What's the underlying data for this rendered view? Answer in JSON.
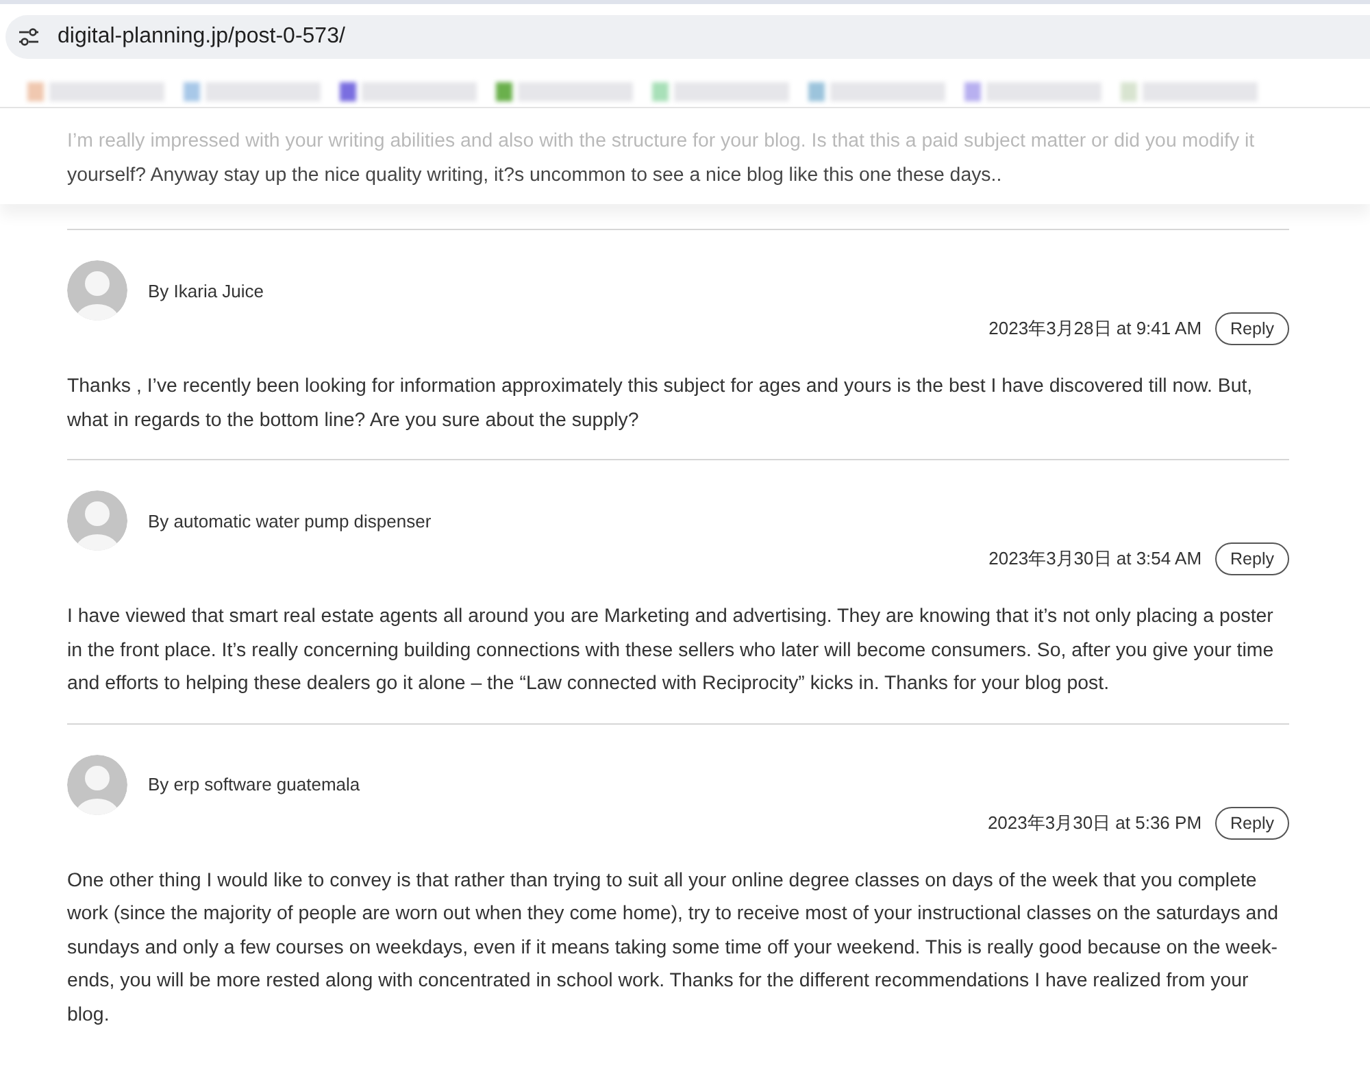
{
  "address_bar": {
    "url": "digital-planning.jp/post-0-573/"
  },
  "bookmarks_bar": {
    "items": [
      {
        "color": "#f0c8b0"
      },
      {
        "color": "#a8c8e8"
      },
      {
        "color": "#7a6ee0"
      },
      {
        "color": "#6ab04c"
      },
      {
        "color": "#a8e0b8"
      },
      {
        "color": "#9cc4dc"
      },
      {
        "color": "#b8b0f0"
      },
      {
        "color": "#d8e4d0"
      }
    ]
  },
  "previous_comment": {
    "text": "I’m really impressed with your writing abilities and also with the structure for your blog. Is that this a paid subject matter or did you modify it yourself? Anyway stay up the nice quality writing, it?s uncommon to see a nice blog like this one these days.."
  },
  "comments": [
    {
      "author": "By Ikaria Juice",
      "date": "2023年3月28日 at 9:41 AM",
      "reply": "Reply",
      "text": "Thanks , I’ve recently been looking for information approximately this subject for ages and yours is the best I have discovered till now. But, what in regards to the bottom line? Are you sure about the supply?"
    },
    {
      "author": "By automatic water pump dispenser",
      "date": "2023年3月30日 at 3:54 AM",
      "reply": "Reply",
      "text": "I have viewed that smart real estate agents all around you are Marketing and advertising. They are knowing that it’s not only placing a poster in the front place. It’s really concerning building connections with these sellers who later will become consumers. So, after you give your time and efforts to helping these dealers go it alone – the “Law connected with Reciprocity” kicks in. Thanks for your blog post."
    },
    {
      "author": "By erp software guatemala",
      "date": "2023年3月30日 at 5:36 PM",
      "reply": "Reply",
      "text": "One other thing I would like to convey is that rather than trying to suit all your online degree classes on days of the week that you complete work (since the majority of people are worn out when they come home), try to receive most of your instructional classes on the saturdays and sundays and only a few courses on weekdays, even if it means taking some time off your weekend. This is really good because on the week-ends, you will be more rested along with concentrated in school work. Thanks for the different recommendations I have realized from your blog."
    }
  ]
}
